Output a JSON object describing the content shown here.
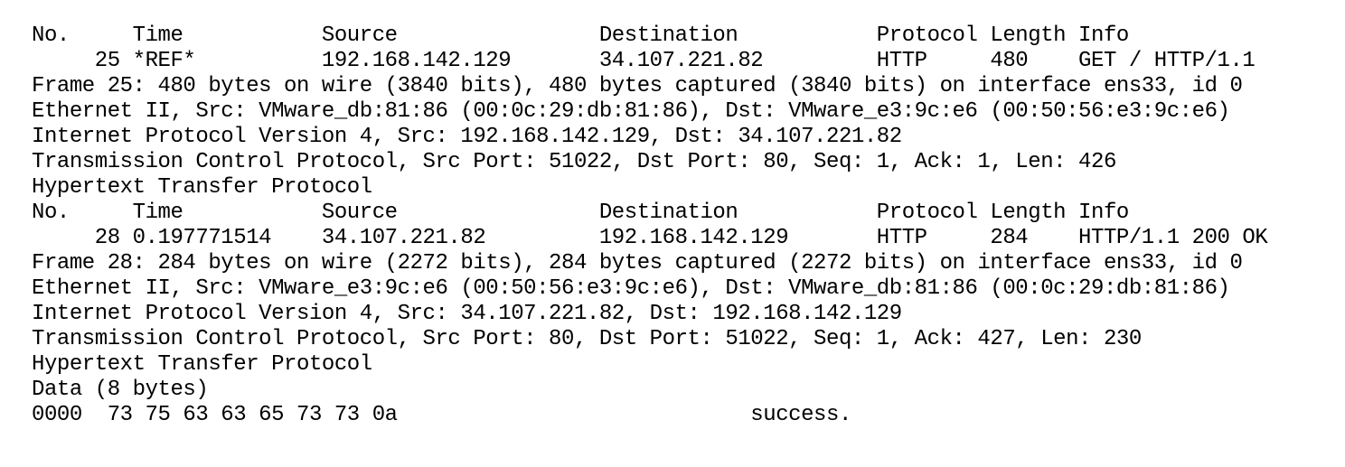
{
  "packets": [
    {
      "header": "No.     Time           Source                Destination           Protocol Length Info",
      "summary": "     25 *REF*          192.168.142.129       34.107.221.82         HTTP     480    GET / HTTP/1.1",
      "frame": "Frame 25: 480 bytes on wire (3840 bits), 480 bytes captured (3840 bits) on interface ens33, id 0",
      "ethernet": "Ethernet II, Src: VMware_db:81:86 (00:0c:29:db:81:86), Dst: VMware_e3:9c:e6 (00:50:56:e3:9c:e6)",
      "ip": "Internet Protocol Version 4, Src: 192.168.142.129, Dst: 34.107.221.82",
      "tcp": "Transmission Control Protocol, Src Port: 51022, Dst Port: 80, Seq: 1, Ack: 1, Len: 426",
      "http": "Hypertext Transfer Protocol"
    },
    {
      "header": "No.     Time           Source                Destination           Protocol Length Info",
      "summary": "     28 0.197771514    34.107.221.82         192.168.142.129       HTTP     284    HTTP/1.1 200 OK",
      "frame": "Frame 28: 284 bytes on wire (2272 bits), 284 bytes captured (2272 bits) on interface ens33, id 0",
      "ethernet": "Ethernet II, Src: VMware_e3:9c:e6 (00:50:56:e3:9c:e6), Dst: VMware_db:81:86 (00:0c:29:db:81:86)",
      "ip": "Internet Protocol Version 4, Src: 34.107.221.82, Dst: 192.168.142.129",
      "tcp": "Transmission Control Protocol, Src Port: 80, Dst Port: 51022, Seq: 1, Ack: 427, Len: 230",
      "http": "Hypertext Transfer Protocol",
      "data": "Data (8 bytes)",
      "hexdump": "0000  73 75 63 63 65 73 73 0a                            success."
    }
  ]
}
